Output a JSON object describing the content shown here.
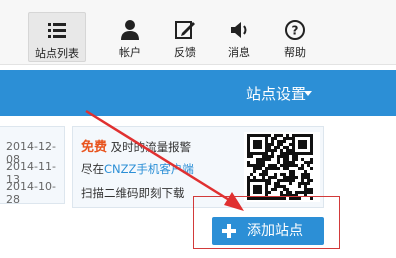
{
  "nav": {
    "items": [
      {
        "label": "站点列表",
        "icon": "list-icon"
      },
      {
        "label": "帐户",
        "icon": "user-icon"
      },
      {
        "label": "反馈",
        "icon": "edit-icon"
      },
      {
        "label": "消息",
        "icon": "speaker-icon"
      },
      {
        "label": "帮助",
        "icon": "question-icon"
      }
    ]
  },
  "toolbar": {
    "site_settings": "站点设置"
  },
  "dates": [
    "2014-12-08",
    "2014-11-13",
    "2014-10-28"
  ],
  "promo": {
    "free": "免费",
    "line1_rest": "及时的流量报警",
    "line2_prefix": "尽在",
    "line2_link": "CNZZ手机客户端",
    "line3": "扫描二维码即刻下载"
  },
  "add_button": {
    "label": "添加站点"
  },
  "colors": {
    "accent": "#2c8fd6",
    "free": "#e8541e",
    "highlight": "#d23a3a"
  }
}
